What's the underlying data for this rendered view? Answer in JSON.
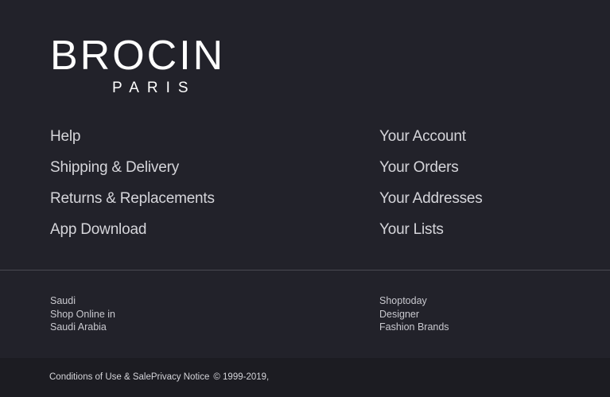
{
  "brand": {
    "name": "BROCIN",
    "sub": "PARIS"
  },
  "help_links": [
    {
      "label": "Help"
    },
    {
      "label": "Shipping & Delivery"
    },
    {
      "label": "Returns & Replacements"
    },
    {
      "label": "App Download"
    }
  ],
  "account_links": [
    {
      "label": "Your Account"
    },
    {
      "label": "Your Orders"
    },
    {
      "label": "Your Addresses"
    },
    {
      "label": "Your Lists"
    }
  ],
  "blurbs": {
    "left": [
      "Saudi",
      "Shop Online in",
      "Saudi Arabia"
    ],
    "right": [
      "Shoptoday",
      "Designer",
      "Fashion Brands"
    ]
  },
  "footer": {
    "conditions": "Conditions of Use & Sale",
    "privacy": "Privacy Notice",
    "copyright": "© 1999-2019,"
  }
}
